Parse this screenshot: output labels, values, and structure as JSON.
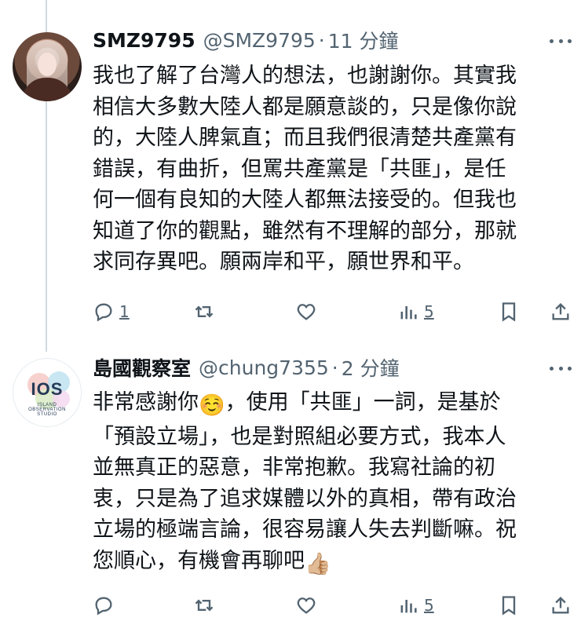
{
  "tweets": [
    {
      "name": "SMZ9795",
      "handle": "@SMZ9795",
      "separator": "·",
      "time": "11 分鐘",
      "lines": [
        "我也了解了台灣人的想法，也謝謝你。其實我",
        "相信大多數大陸人都是願意談的，只是像你說",
        "的，大陸人脾氣直；而且我們很清楚共產黨有",
        "錯誤，有曲折，但罵共產黨是「共匪」，是任",
        "何一個有良知的大陸人都無法接受的。但我也",
        "知道了你的觀點，雖然有不理解的部分，那就",
        "求同存異吧。願兩岸和平，願世界和平。"
      ],
      "reply_count": "1",
      "views_count": "5"
    },
    {
      "name": "島國觀察室",
      "handle": "@chung7355",
      "separator": "·",
      "time": "2 分鐘",
      "avatar_text": "IOS",
      "avatar_subtext": "ISLAND OBSERVATION STUDIO",
      "lines": [
        "非常感謝你",
        "「預設立場」，也是對照組必要方式，我本人",
        "並無真正的惡意，非常抱歉。我寫社論的初",
        "衷，只是為了追求媒體以外的真相，帶有政治",
        "立場的極端言論，很容易讓人失去判斷嘛。祝",
        "您順心，有機會再聊吧"
      ],
      "line0_suffix": "，使用「共匪」一詞，是基於",
      "emoji_1": "☺️",
      "emoji_2": "👍🏼",
      "views_count": "5"
    }
  ],
  "icons": [
    "reply-icon",
    "retweet-icon",
    "like-icon",
    "views-icon",
    "bookmark-icon",
    "share-icon",
    "more-icon"
  ],
  "colors": {
    "text": "#0f1419",
    "secondary": "#536471",
    "thread_line": "#cfd9de"
  }
}
